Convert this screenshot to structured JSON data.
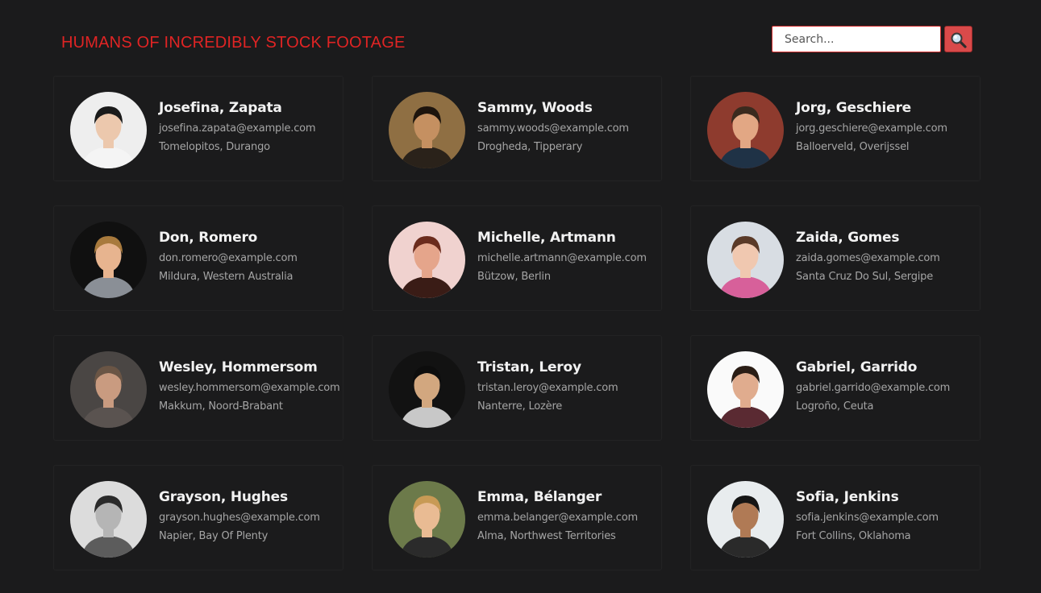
{
  "header": {
    "title": "HUMANS OF INCREDIBLY STOCK FOOTAGE",
    "title_color": "#e02424"
  },
  "search": {
    "placeholder": "Search...",
    "value": "",
    "button_icon": "search-icon",
    "button_color": "#d94a4a"
  },
  "people": [
    {
      "name": "Josefina, Zapata",
      "email": "josefina.zapata@example.com",
      "location": "Tomelopitos, Durango",
      "avatar": {
        "bg": "#eeeeee",
        "skin": "#ecc8ad",
        "hair": "#1a1a1a",
        "shirt": "#f4f4f4"
      }
    },
    {
      "name": "Sammy, Woods",
      "email": "sammy.woods@example.com",
      "location": "Drogheda, Tipperary",
      "avatar": {
        "bg": "#8f6f43",
        "skin": "#c59061",
        "hair": "#1d140d",
        "shirt": "#2a221a"
      }
    },
    {
      "name": "Jorg, Geschiere",
      "email": "jorg.geschiere@example.com",
      "location": "Balloerveld, Overijssel",
      "avatar": {
        "bg": "#8e3b2e",
        "skin": "#e2a784",
        "hair": "#3a2a1e",
        "shirt": "#1f3246"
      }
    },
    {
      "name": "Don, Romero",
      "email": "don.romero@example.com",
      "location": "Mildura, Western Australia",
      "avatar": {
        "bg": "#101010",
        "skin": "#e7b48f",
        "hair": "#a87a3d",
        "shirt": "#8a8f96"
      }
    },
    {
      "name": "Michelle, Artmann",
      "email": "michelle.artmann@example.com",
      "location": "Bützow, Berlin",
      "avatar": {
        "bg": "#f0d2cf",
        "skin": "#e5a58b",
        "hair": "#6b2b1c",
        "shirt": "#3a1c16"
      }
    },
    {
      "name": "Zaida, Gomes",
      "email": "zaida.gomes@example.com",
      "location": "Santa Cruz Do Sul, Sergipe",
      "avatar": {
        "bg": "#d8dde3",
        "skin": "#f0c8b0",
        "hair": "#5a3a28",
        "shirt": "#d7609a"
      }
    },
    {
      "name": "Wesley, Hommersom",
      "email": "wesley.hommersom@example.com",
      "location": "Makkum, Noord-Brabant",
      "avatar": {
        "bg": "#4a4644",
        "skin": "#c99b80",
        "hair": "#6a5545",
        "shirt": "#5a5350"
      }
    },
    {
      "name": "Tristan, Leroy",
      "email": "tristan.leroy@example.com",
      "location": "Nanterre, Lozère",
      "avatar": {
        "bg": "#121212",
        "skin": "#d2a77f",
        "hair": "#0d0d0d",
        "shirt": "#c8c8c8"
      }
    },
    {
      "name": "Gabriel, Garrido",
      "email": "gabriel.garrido@example.com",
      "location": "Logroño, Ceuta",
      "avatar": {
        "bg": "#fafafa",
        "skin": "#e0ac8e",
        "hair": "#2a1d15",
        "shirt": "#5a2a32"
      }
    },
    {
      "name": "Grayson, Hughes",
      "email": "grayson.hughes@example.com",
      "location": "Napier, Bay Of Plenty",
      "avatar": {
        "bg": "#dcdcdc",
        "skin": "#b5b5b5",
        "hair": "#2a2a2a",
        "shirt": "#5c5c5c"
      }
    },
    {
      "name": "Emma, Bélanger",
      "email": "emma.belanger@example.com",
      "location": "Alma, Northwest Territories",
      "avatar": {
        "bg": "#6c7a4a",
        "skin": "#e9bb93",
        "hair": "#c89a55",
        "shirt": "#2b2b2b"
      }
    },
    {
      "name": "Sofia, Jenkins",
      "email": "sofia.jenkins@example.com",
      "location": "Fort Collins, Oklahoma",
      "avatar": {
        "bg": "#e8ecee",
        "skin": "#b07a55",
        "hair": "#151515",
        "shirt": "#2a2a2a"
      }
    }
  ]
}
